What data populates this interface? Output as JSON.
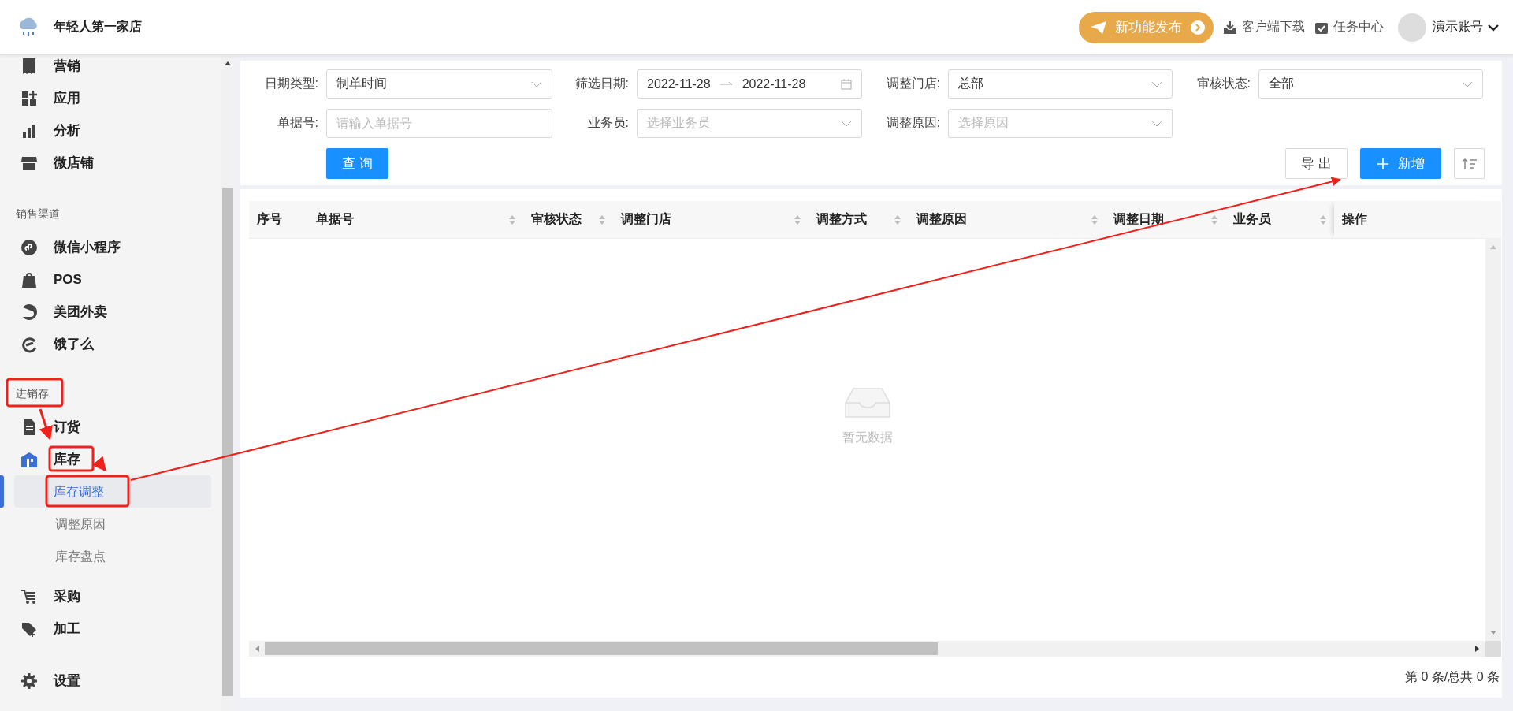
{
  "header": {
    "store_name": "年轻人第一家店",
    "release_button": "新功能发布",
    "download_link": "客户端下载",
    "task_center": "任务中心",
    "account": "演示账号"
  },
  "sidebar": {
    "sections": [
      {
        "items": [
          {
            "label": "营销",
            "expanded": false
          },
          {
            "label": "应用",
            "expanded": false
          },
          {
            "label": "分析",
            "expanded": false
          },
          {
            "label": "微店铺",
            "expanded": false
          }
        ]
      },
      {
        "title": "销售渠道",
        "items": [
          {
            "label": "微信小程序",
            "expanded": false
          },
          {
            "label": "POS",
            "expanded": false
          },
          {
            "label": "美团外卖",
            "expanded": false
          },
          {
            "label": "饿了么",
            "expanded": false
          }
        ]
      },
      {
        "title": "进销存",
        "items": [
          {
            "label": "订货",
            "expanded": false
          },
          {
            "label": "库存",
            "expanded": true,
            "children": [
              {
                "label": "库存调整",
                "selected": true
              },
              {
                "label": "调整原因",
                "selected": false
              },
              {
                "label": "库存盘点",
                "selected": false
              }
            ]
          },
          {
            "label": "采购",
            "expanded": false
          },
          {
            "label": "加工",
            "expanded": false
          }
        ]
      },
      {
        "items": [
          {
            "label": "设置",
            "expanded": false
          }
        ]
      }
    ]
  },
  "filters": [
    {
      "kind": "select",
      "label": "日期类型:",
      "value": "制单时间"
    },
    {
      "kind": "daterange",
      "label": "筛选日期:",
      "start": "2022-11-28",
      "end": "2022-11-28"
    },
    {
      "kind": "select",
      "label": "调整门店:",
      "value": "总部"
    },
    {
      "kind": "select",
      "label": "审核状态:",
      "value": "全部"
    },
    {
      "kind": "input",
      "label": "单据号:",
      "placeholder": "请输入单据号"
    },
    {
      "kind": "select",
      "label": "业务员:",
      "placeholder": "选择业务员"
    },
    {
      "kind": "select",
      "label": "调整原因:",
      "placeholder": "选择原因"
    }
  ],
  "buttons": {
    "query": "查 询",
    "export": "导 出",
    "add": "新增"
  },
  "table": {
    "columns": [
      {
        "label": "序号",
        "sortable": false
      },
      {
        "label": "单据号",
        "sortable": true
      },
      {
        "label": "审核状态",
        "sortable": true
      },
      {
        "label": "调整门店",
        "sortable": true
      },
      {
        "label": "调整方式",
        "sortable": true
      },
      {
        "label": "调整原因",
        "sortable": true
      },
      {
        "label": "调整日期",
        "sortable": true
      },
      {
        "label": "业务员",
        "sortable": true
      },
      {
        "label": "操作",
        "sortable": false
      }
    ],
    "empty_text": "暂无数据"
  },
  "pagination": "第 0 条/总共 0 条"
}
